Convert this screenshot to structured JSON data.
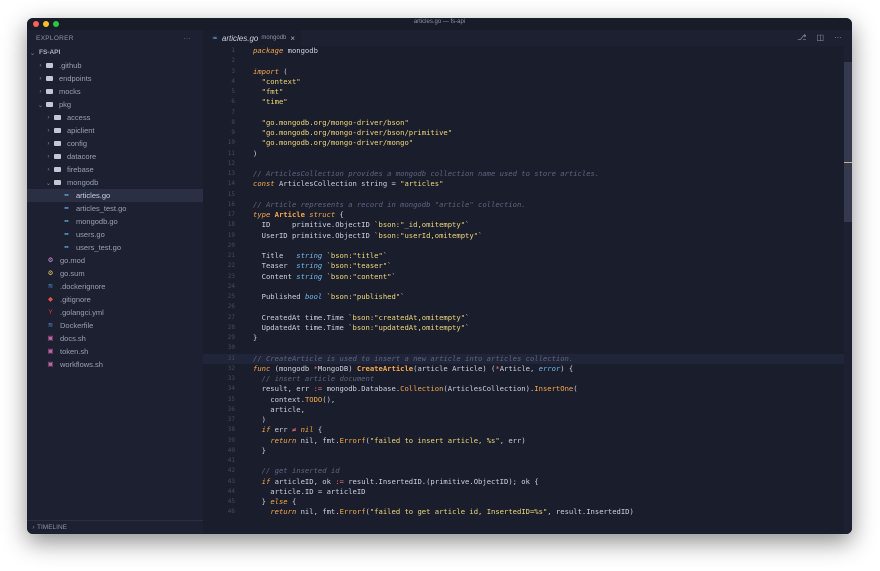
{
  "window": {
    "title": "articles.go — fs-api",
    "lights": [
      "#fe5f57",
      "#febc2e",
      "#28c840"
    ]
  },
  "sidebar": {
    "header": "EXPLORER",
    "more": "···",
    "timeline": "TIMELINE",
    "items": [
      {
        "label": "FS-API",
        "depth": 0,
        "chev": "v",
        "icon": "none",
        "root": true
      },
      {
        "label": ".github",
        "depth": 1,
        "chev": ">",
        "icon": "folder"
      },
      {
        "label": "endpoints",
        "depth": 1,
        "chev": ">",
        "icon": "folder"
      },
      {
        "label": "mocks",
        "depth": 1,
        "chev": ">",
        "icon": "folder"
      },
      {
        "label": "pkg",
        "depth": 1,
        "chev": "v",
        "icon": "folder"
      },
      {
        "label": "access",
        "depth": 2,
        "chev": ">",
        "icon": "folder"
      },
      {
        "label": "apiclient",
        "depth": 2,
        "chev": ">",
        "icon": "folder"
      },
      {
        "label": "config",
        "depth": 2,
        "chev": ">",
        "icon": "folder"
      },
      {
        "label": "datacore",
        "depth": 2,
        "chev": ">",
        "icon": "folder"
      },
      {
        "label": "firebase",
        "depth": 2,
        "chev": ">",
        "icon": "folder"
      },
      {
        "label": "mongodb",
        "depth": 2,
        "chev": "v",
        "icon": "folder"
      },
      {
        "label": "articles.go",
        "depth": 3,
        "chev": "",
        "icon": "go",
        "selected": true
      },
      {
        "label": "articles_test.go",
        "depth": 3,
        "chev": "",
        "icon": "go"
      },
      {
        "label": "mongodb.go",
        "depth": 3,
        "chev": "",
        "icon": "go"
      },
      {
        "label": "users.go",
        "depth": 3,
        "chev": "",
        "icon": "go"
      },
      {
        "label": "users_test.go",
        "depth": 3,
        "chev": "",
        "icon": "go"
      },
      {
        "label": "go.mod",
        "depth": 1,
        "chev": "",
        "icon": "gomod"
      },
      {
        "label": "go.sum",
        "depth": 1,
        "chev": "",
        "icon": "gosum"
      },
      {
        "label": ".dockerignore",
        "depth": 1,
        "chev": "",
        "icon": "docker"
      },
      {
        "label": ".gitignore",
        "depth": 1,
        "chev": "",
        "icon": "git"
      },
      {
        "label": ".golangci.yml",
        "depth": 1,
        "chev": "",
        "icon": "yaml"
      },
      {
        "label": "Dockerfile",
        "depth": 1,
        "chev": "",
        "icon": "docker"
      },
      {
        "label": "docs.sh",
        "depth": 1,
        "chev": "",
        "icon": "shell"
      },
      {
        "label": "token.sh",
        "depth": 1,
        "chev": "",
        "icon": "shell"
      },
      {
        "label": "workflows.sh",
        "depth": 1,
        "chev": "",
        "icon": "shell"
      }
    ]
  },
  "tab": {
    "label": "articles.go",
    "description": "mongodb",
    "close": "×"
  },
  "toolbar_icons": [
    "source-control-icon",
    "split-editor-icon",
    "more-actions-icon"
  ],
  "code": {
    "active_line": 31,
    "lines": [
      {
        "n": "1",
        "t": [
          [
            "kw",
            "package"
          ],
          [
            "pl",
            " mongodb"
          ]
        ]
      },
      {
        "n": "2",
        "t": []
      },
      {
        "n": "3",
        "t": [
          [
            "kw",
            "import"
          ],
          [
            "pl",
            " ("
          ]
        ]
      },
      {
        "n": "4",
        "t": [
          [
            "pl",
            "  "
          ],
          [
            "str",
            "\"context\""
          ]
        ]
      },
      {
        "n": "5",
        "t": [
          [
            "pl",
            "  "
          ],
          [
            "str",
            "\"fmt\""
          ]
        ]
      },
      {
        "n": "6",
        "t": [
          [
            "pl",
            "  "
          ],
          [
            "str",
            "\"time\""
          ]
        ]
      },
      {
        "n": "7",
        "t": []
      },
      {
        "n": "8",
        "t": [
          [
            "pl",
            "  "
          ],
          [
            "str",
            "\"go.mongodb.org/mongo-driver/bson\""
          ]
        ]
      },
      {
        "n": "9",
        "t": [
          [
            "pl",
            "  "
          ],
          [
            "str",
            "\"go.mongodb.org/mongo-driver/bson/primitive\""
          ]
        ]
      },
      {
        "n": "10",
        "t": [
          [
            "pl",
            "  "
          ],
          [
            "str",
            "\"go.mongodb.org/mongo-driver/mongo\""
          ]
        ]
      },
      {
        "n": "11",
        "t": [
          [
            "pl",
            ")"
          ]
        ]
      },
      {
        "n": "12",
        "t": []
      },
      {
        "n": "13",
        "t": [
          [
            "cm",
            "// ArticlesCollection provides a mongodb collection name used to store articles."
          ]
        ]
      },
      {
        "n": "14",
        "t": [
          [
            "kw",
            "const"
          ],
          [
            "pl",
            " ArticlesCollection string = "
          ],
          [
            "str",
            "\"articles\""
          ]
        ]
      },
      {
        "n": "15",
        "t": []
      },
      {
        "n": "16",
        "t": [
          [
            "cm",
            "// Article represents a record in mongodb \"article\" collection."
          ]
        ]
      },
      {
        "n": "17",
        "t": [
          [
            "kw",
            "type"
          ],
          [
            "pl",
            " "
          ],
          [
            "fnb",
            "Article"
          ],
          [
            "pl",
            " "
          ],
          [
            "kw",
            "struct"
          ],
          [
            "pl",
            " {"
          ]
        ]
      },
      {
        "n": "18",
        "t": [
          [
            "pl",
            "  ID     primitive.ObjectID "
          ],
          [
            "str",
            "`bson:\"_id,omitempty\"`"
          ]
        ]
      },
      {
        "n": "19",
        "t": [
          [
            "pl",
            "  UserID primitive.ObjectID "
          ],
          [
            "str",
            "`bson:\"userId,omitempty\"`"
          ]
        ]
      },
      {
        "n": "20",
        "t": []
      },
      {
        "n": "21",
        "t": [
          [
            "pl",
            "  Title   "
          ],
          [
            "ty",
            "string"
          ],
          [
            "pl",
            " "
          ],
          [
            "str",
            "`bson:\"title\"`"
          ]
        ]
      },
      {
        "n": "22",
        "t": [
          [
            "pl",
            "  Teaser  "
          ],
          [
            "ty",
            "string"
          ],
          [
            "pl",
            " "
          ],
          [
            "str",
            "`bson:\"teaser\"`"
          ]
        ]
      },
      {
        "n": "23",
        "t": [
          [
            "pl",
            "  Content "
          ],
          [
            "ty",
            "string"
          ],
          [
            "pl",
            " "
          ],
          [
            "str",
            "`bson:\"content\"`"
          ]
        ]
      },
      {
        "n": "24",
        "t": []
      },
      {
        "n": "25",
        "t": [
          [
            "pl",
            "  Published "
          ],
          [
            "ty",
            "bool"
          ],
          [
            "pl",
            " "
          ],
          [
            "str",
            "`bson:\"published\"`"
          ]
        ]
      },
      {
        "n": "26",
        "t": []
      },
      {
        "n": "27",
        "t": [
          [
            "pl",
            "  CreatedAt time.Time "
          ],
          [
            "str",
            "`bson:\"createdAt,omitempty\"`"
          ]
        ]
      },
      {
        "n": "28",
        "t": [
          [
            "pl",
            "  UpdatedAt time.Time "
          ],
          [
            "str",
            "`bson:\"updatedAt,omitempty\"`"
          ]
        ]
      },
      {
        "n": "29",
        "t": [
          [
            "pl",
            "}"
          ]
        ]
      },
      {
        "n": "30",
        "t": []
      },
      {
        "n": "31",
        "t": [
          [
            "cm",
            "// CreateArticle is used to insert a new article into articles collection."
          ]
        ]
      },
      {
        "n": "32",
        "t": [
          [
            "kw",
            "func"
          ],
          [
            "pl",
            " (mongodb "
          ],
          [
            "op",
            "*"
          ],
          [
            "pl",
            "MongoDB) "
          ],
          [
            "fnb",
            "CreateArticle"
          ],
          [
            "pl",
            "(article Article) ("
          ],
          [
            "op",
            "*"
          ],
          [
            "pl",
            "Article, "
          ],
          [
            "ty",
            "error"
          ],
          [
            "pl",
            ") {"
          ]
        ]
      },
      {
        "n": "33",
        "t": [
          [
            "pl",
            "  "
          ],
          [
            "cm",
            "// insert article document"
          ]
        ]
      },
      {
        "n": "34",
        "t": [
          [
            "pl",
            "  result, err "
          ],
          [
            "op",
            ":="
          ],
          [
            "pl",
            " mongodb.Database."
          ],
          [
            "fn",
            "Collection"
          ],
          [
            "pl",
            "(ArticlesCollection)."
          ],
          [
            "fn",
            "InsertOne"
          ],
          [
            "pl",
            "("
          ]
        ]
      },
      {
        "n": "35",
        "t": [
          [
            "pl",
            "    context."
          ],
          [
            "fn",
            "TODO"
          ],
          [
            "pl",
            "(),"
          ]
        ]
      },
      {
        "n": "36",
        "t": [
          [
            "pl",
            "    article,"
          ]
        ]
      },
      {
        "n": "37",
        "t": [
          [
            "pl",
            "  )"
          ]
        ]
      },
      {
        "n": "38",
        "t": [
          [
            "pl",
            "  "
          ],
          [
            "kw",
            "if"
          ],
          [
            "pl",
            " err "
          ],
          [
            "op",
            "≠"
          ],
          [
            "pl",
            " "
          ],
          [
            "kw",
            "nil"
          ],
          [
            "pl",
            " {"
          ]
        ]
      },
      {
        "n": "39",
        "t": [
          [
            "pl",
            "    "
          ],
          [
            "kw",
            "return"
          ],
          [
            "pl",
            " nil, fmt."
          ],
          [
            "fn",
            "Errorf"
          ],
          [
            "pl",
            "("
          ],
          [
            "str",
            "\"failed to insert article, %s\""
          ],
          [
            "pl",
            ", err)"
          ]
        ]
      },
      {
        "n": "40",
        "t": [
          [
            "pl",
            "  }"
          ]
        ]
      },
      {
        "n": "41",
        "t": []
      },
      {
        "n": "42",
        "t": [
          [
            "pl",
            "  "
          ],
          [
            "cm",
            "// get inserted id"
          ]
        ]
      },
      {
        "n": "43",
        "t": [
          [
            "pl",
            "  "
          ],
          [
            "kw",
            "if"
          ],
          [
            "pl",
            " articleID, ok "
          ],
          [
            "op",
            ":="
          ],
          [
            "pl",
            " result.InsertedID.(primitive.ObjectID); ok {"
          ]
        ]
      },
      {
        "n": "44",
        "t": [
          [
            "pl",
            "    article.ID = articleID"
          ]
        ]
      },
      {
        "n": "45",
        "t": [
          [
            "pl",
            "  } "
          ],
          [
            "kw",
            "else"
          ],
          [
            "pl",
            " {"
          ]
        ]
      },
      {
        "n": "46",
        "t": [
          [
            "pl",
            "    "
          ],
          [
            "kw",
            "return"
          ],
          [
            "pl",
            " nil, fmt."
          ],
          [
            "fn",
            "Errorf"
          ],
          [
            "pl",
            "("
          ],
          [
            "str",
            "\"failed to get article id, InsertedID=%s\""
          ],
          [
            "pl",
            ", result.InsertedID)"
          ]
        ]
      }
    ]
  }
}
